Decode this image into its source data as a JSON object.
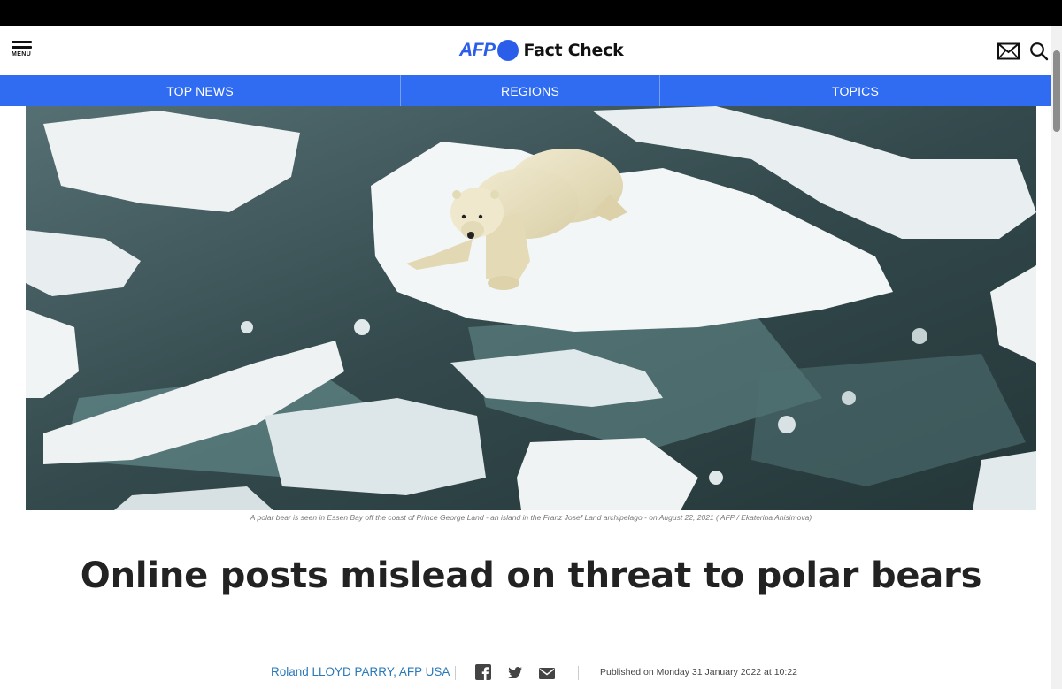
{
  "header": {
    "menu_label": "MENU",
    "brand_afp": "AFP",
    "brand_title": "Fact Check",
    "mail_icon": "mail-icon",
    "search_icon": "search-icon",
    "accent": "#2f6cf2"
  },
  "nav": {
    "tabs": [
      {
        "label": "TOP NEWS"
      },
      {
        "label": "REGIONS"
      },
      {
        "label": "TOPICS"
      }
    ]
  },
  "article": {
    "photo_caption": "A polar bear is seen in Essen Bay off the coast of Prince George Land - an island in the Franz Josef Land archipelago - on August 22, 2021 ( AFP / Ekaterina Anisimova)",
    "title": "Online posts mislead on threat to polar bears",
    "author": "Roland LLOYD PARRY, AFP USA",
    "share_icons": [
      "facebook-icon",
      "twitter-icon",
      "email-icon"
    ],
    "published": "Published on Monday 31 January 2022 at 10:22"
  }
}
